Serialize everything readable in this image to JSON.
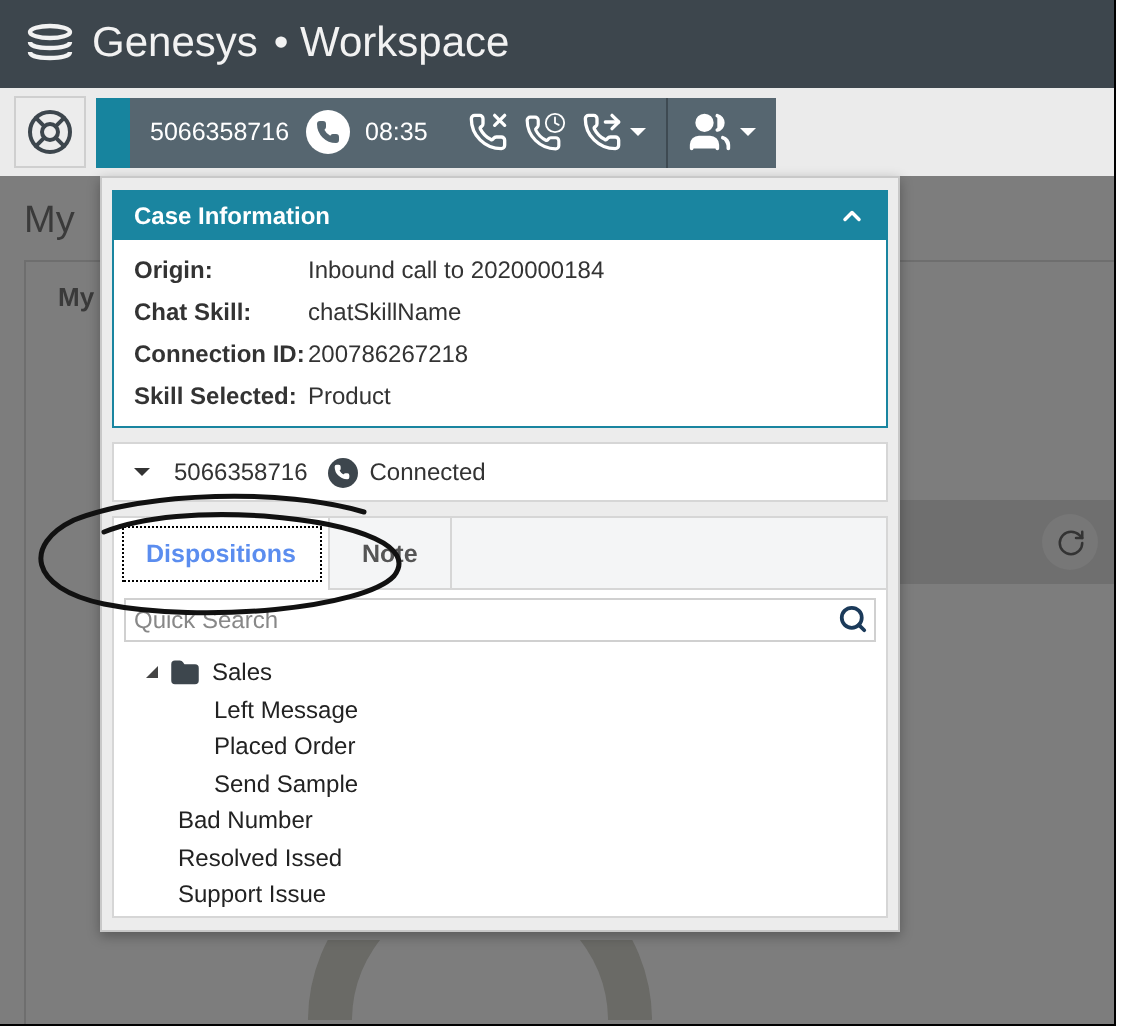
{
  "title_bar": {
    "brand": "Genesys",
    "product": "• Workspace"
  },
  "call_toolbar": {
    "phone_number": "5066358716",
    "duration": "08:35"
  },
  "background": {
    "heading": "My",
    "tab": "My"
  },
  "case_information": {
    "title": "Case Information",
    "expanded": true,
    "fields": [
      {
        "label": "Origin:",
        "value": "Inbound call to 2020000184"
      },
      {
        "label": "Chat Skill:",
        "value": "chatSkillName"
      },
      {
        "label": "Connection ID:",
        "value": "200786267218"
      },
      {
        "label": "Skill Selected:",
        "value": "Product"
      }
    ]
  },
  "interaction": {
    "expanded": true,
    "phone_number": "5066358716",
    "status": "Connected"
  },
  "tabs": [
    {
      "label": "Dispositions",
      "selected": true
    },
    {
      "label": "Note",
      "selected": false
    }
  ],
  "search": {
    "placeholder": "Quick Search"
  },
  "dispositions": [
    {
      "label": "Sales",
      "kind": "folder",
      "expanded": true,
      "children": [
        {
          "label": "Left Message",
          "kind": "item"
        },
        {
          "label": "Placed Order",
          "kind": "item"
        },
        {
          "label": "Send Sample",
          "kind": "item"
        }
      ]
    },
    {
      "label": "Bad Number",
      "kind": "item"
    },
    {
      "label": "Resolved Issed",
      "kind": "item"
    },
    {
      "label": "Support Issue",
      "kind": "item"
    }
  ]
}
